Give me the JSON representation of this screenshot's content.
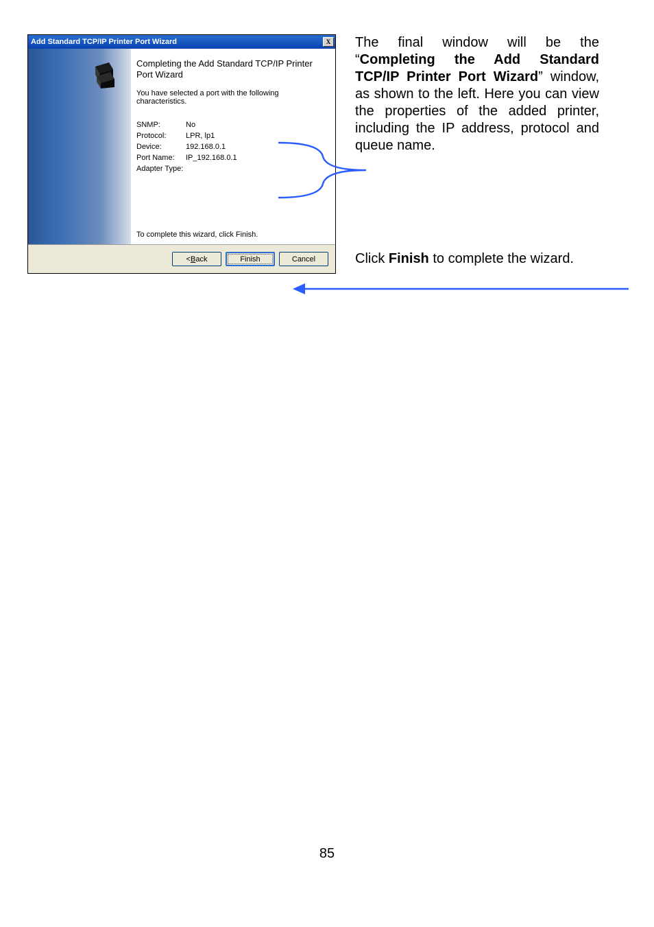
{
  "wizard": {
    "title": "Add Standard TCP/IP Printer Port Wizard",
    "close_label": "X",
    "heading": "Completing the Add Standard TCP/IP Printer Port Wizard",
    "subtext": "You have selected a port with the following characteristics.",
    "props": [
      {
        "label": "SNMP:",
        "value": "No"
      },
      {
        "label": "Protocol:",
        "value": "LPR, lp1"
      },
      {
        "label": "Device:",
        "value": "192.168.0.1"
      },
      {
        "label": "Port Name:",
        "value": "IP_192.168.0.1"
      },
      {
        "label": "Adapter Type:",
        "value": ""
      }
    ],
    "complete_text": "To complete this wizard, click Finish.",
    "buttons": {
      "back_prefix": "< ",
      "back_underline": "B",
      "back_suffix": "ack",
      "finish": "Finish",
      "cancel": "Cancel"
    }
  },
  "explain": {
    "p1_a": "The final window will be the “",
    "p1_bold": "Completing the Add Standard TCP/IP Printer Port Wizard",
    "p1_b": "” window, as shown to the left. Here you can view the properties of the added printer, including the IP address, protocol and queue name.",
    "p2_a": "Click ",
    "p2_bold": "Finish",
    "p2_b": " to complete the wizard."
  },
  "page_number": "85"
}
